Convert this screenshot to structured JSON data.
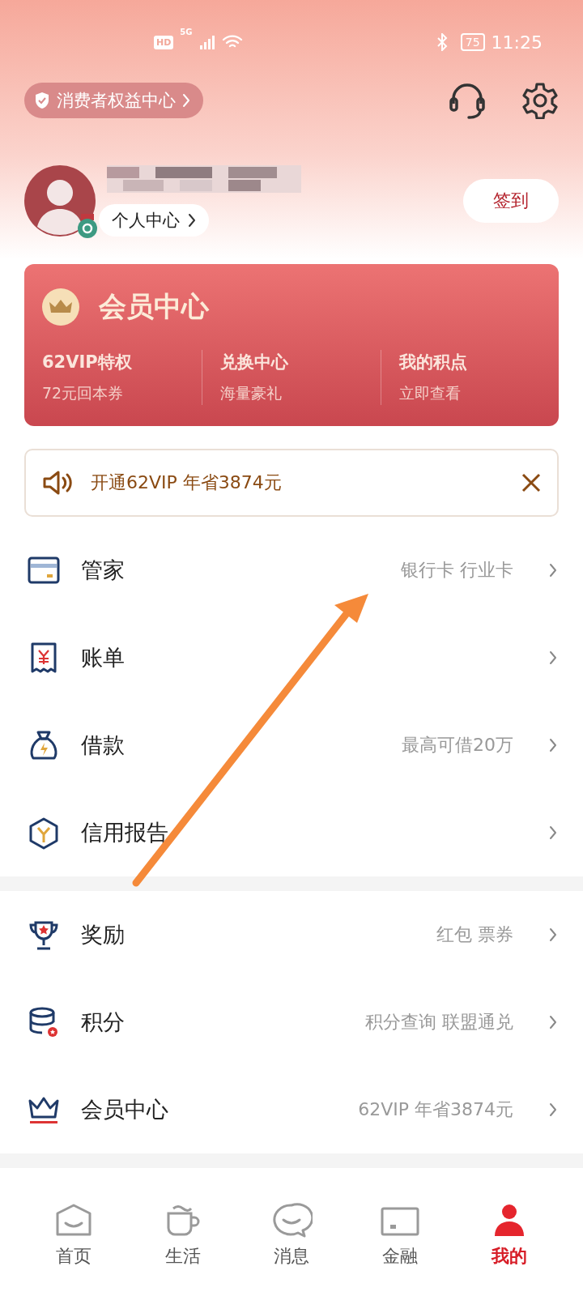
{
  "status_bar": {
    "hd": "HD",
    "network": "5G",
    "battery": "75",
    "time": "11:25"
  },
  "header": {
    "rights_link": "消费者权益中心",
    "profile_link": "个人中心",
    "checkin_button": "签到"
  },
  "member_card": {
    "title": "会员中心",
    "items": [
      {
        "title": "62VIP特权",
        "subtitle": "72元回本券"
      },
      {
        "title": "兑换中心",
        "subtitle": "海量豪礼"
      },
      {
        "title": "我的积点",
        "subtitle": "立即查看"
      }
    ]
  },
  "notice": {
    "text": "开通62VIP 年省3874元"
  },
  "menu_groups": [
    [
      {
        "label": "管家",
        "detail": "银行卡 行业卡"
      },
      {
        "label": "账单"
      },
      {
        "label": "借款",
        "detail": "最高可借20万"
      },
      {
        "label": "信用报告"
      }
    ],
    [
      {
        "label": "奖励",
        "detail": "红包 票券"
      },
      {
        "label": "积分",
        "detail": "积分查询 联盟通兑"
      },
      {
        "label": "会员中心",
        "detail": "62VIP 年省3874元"
      }
    ]
  ],
  "tab_bar": [
    {
      "label": "首页",
      "selected": false
    },
    {
      "label": "生活",
      "selected": false
    },
    {
      "label": "消息",
      "selected": false
    },
    {
      "label": "金融",
      "selected": false
    },
    {
      "label": "我的",
      "selected": true
    }
  ]
}
